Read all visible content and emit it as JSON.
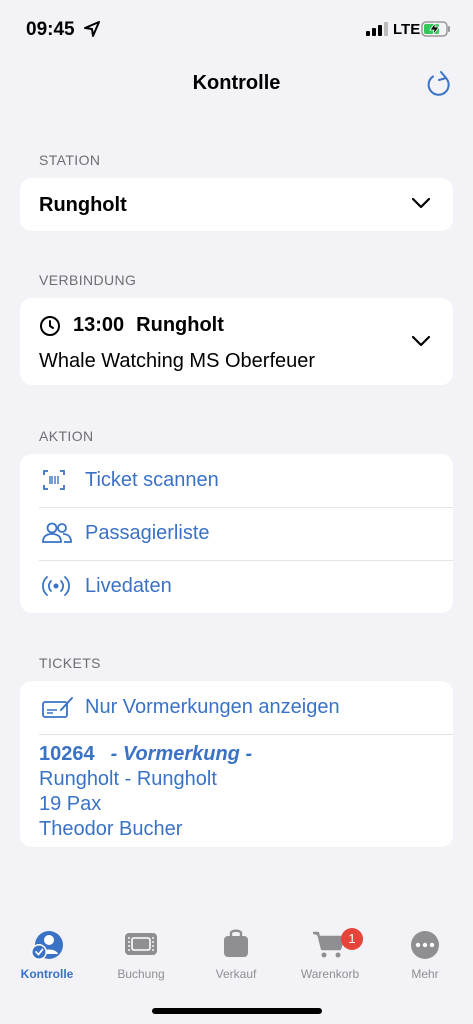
{
  "status_bar": {
    "time": "09:45",
    "network": "LTE"
  },
  "nav": {
    "title": "Kontrolle"
  },
  "station": {
    "section_label": "STATION",
    "value": "Rungholt"
  },
  "connection": {
    "section_label": "VERBINDUNG",
    "time": "13:00",
    "station": "Rungholt",
    "name": "Whale Watching MS Oberfeuer"
  },
  "actions": {
    "section_label": "AKTION",
    "items": [
      {
        "label": "Ticket scannen",
        "icon": "scan-icon"
      },
      {
        "label": "Passagierliste",
        "icon": "people-icon"
      },
      {
        "label": "Livedaten",
        "icon": "broadcast-icon"
      }
    ]
  },
  "tickets": {
    "section_label": "TICKETS",
    "filter_label": "Nur Vormerkungen anzeigen",
    "items": [
      {
        "id": "10264",
        "type": "- Vormerkung -",
        "route": "Rungholt - Rungholt",
        "pax": "19 Pax",
        "name": "Theodor Bucher"
      }
    ]
  },
  "tabbar": {
    "tabs": [
      {
        "label": "Kontrolle",
        "icon": "person-check-icon",
        "active": true
      },
      {
        "label": "Buchung",
        "icon": "ticket-icon"
      },
      {
        "label": "Verkauf",
        "icon": "bag-icon"
      },
      {
        "label": "Warenkorb",
        "icon": "cart-icon",
        "badge": "1"
      },
      {
        "label": "Mehr",
        "icon": "more-icon"
      }
    ]
  },
  "colors": {
    "accent": "#3a72c6",
    "background": "#f2f2f7",
    "badge": "#e5443a"
  }
}
